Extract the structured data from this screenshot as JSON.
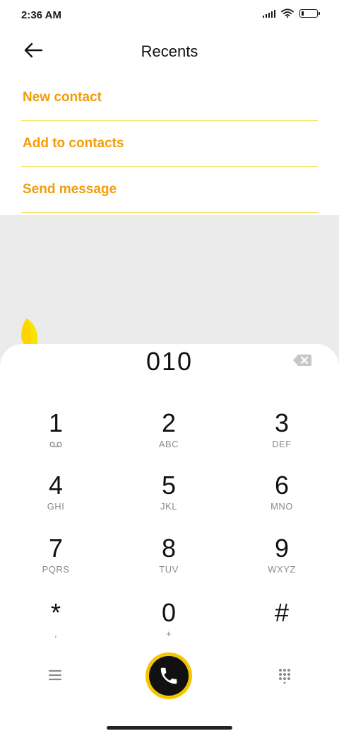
{
  "status_bar": {
    "time": "2:36 AM"
  },
  "header": {
    "title": "Recents"
  },
  "menu": {
    "items": [
      {
        "label": "New contact"
      },
      {
        "label": "Add to contacts"
      },
      {
        "label": "Send message"
      }
    ]
  },
  "dialer": {
    "number": "010",
    "keys": [
      {
        "digit": "1",
        "letters": ""
      },
      {
        "digit": "2",
        "letters": "ABC"
      },
      {
        "digit": "3",
        "letters": "DEF"
      },
      {
        "digit": "4",
        "letters": "GHI"
      },
      {
        "digit": "5",
        "letters": "JKL"
      },
      {
        "digit": "6",
        "letters": "MNO"
      },
      {
        "digit": "7",
        "letters": "PQRS"
      },
      {
        "digit": "8",
        "letters": "TUV"
      },
      {
        "digit": "9",
        "letters": "WXYZ"
      },
      {
        "digit": "*",
        "letters": ","
      },
      {
        "digit": "0",
        "letters": "+"
      },
      {
        "digit": "#",
        "letters": ""
      }
    ]
  },
  "icons": {
    "back": "arrow-left-icon",
    "backspace": "backspace-icon",
    "voicemail": "voicemail-icon",
    "menu": "hamburger-menu-icon",
    "call": "phone-icon",
    "dialpad": "dialpad-grid-icon"
  },
  "colors": {
    "accent": "#f29d0a",
    "divider": "#f2dd47",
    "call_ring": "#f3c600",
    "call_fill": "#111111"
  }
}
